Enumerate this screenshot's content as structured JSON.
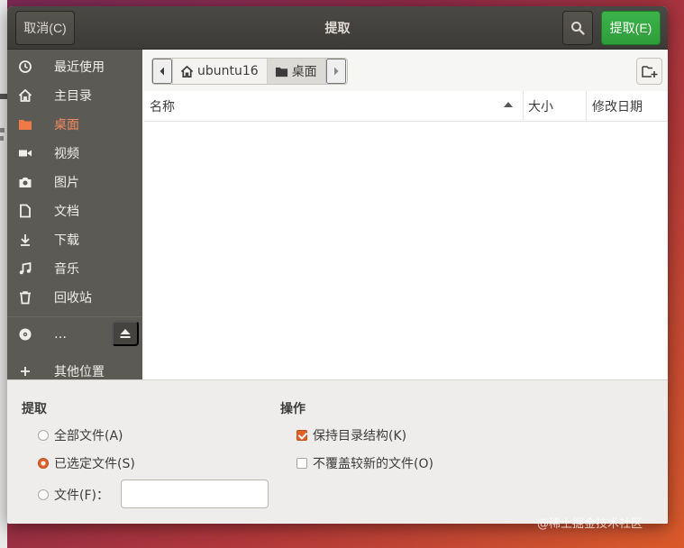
{
  "header": {
    "cancel_label": "取消(C)",
    "title": "提取",
    "extract_label": "提取(E)"
  },
  "sidebar": {
    "items": [
      {
        "label": "最近使用",
        "icon": "clock-icon"
      },
      {
        "label": "主目录",
        "icon": "home-icon"
      },
      {
        "label": "桌面",
        "icon": "folder-icon",
        "active": true
      },
      {
        "label": "视频",
        "icon": "video-icon"
      },
      {
        "label": "图片",
        "icon": "camera-icon"
      },
      {
        "label": "文档",
        "icon": "document-icon"
      },
      {
        "label": "下载",
        "icon": "download-icon"
      },
      {
        "label": "音乐",
        "icon": "music-icon"
      },
      {
        "label": "回收站",
        "icon": "trash-icon"
      },
      {
        "label": "…",
        "icon": "disc-icon"
      },
      {
        "label": "其他位置",
        "icon": "plus-icon"
      }
    ]
  },
  "pathbar": {
    "segments": [
      {
        "label": "ubuntu16",
        "icon": "home-icon"
      },
      {
        "label": "桌面",
        "icon": "folder-icon",
        "active": true
      }
    ]
  },
  "filelist": {
    "columns": [
      "名称",
      "大小",
      "修改日期"
    ]
  },
  "options": {
    "extract": {
      "title": "提取",
      "all_files": "全部文件(A)",
      "selected_files": "已选定文件(S)",
      "files": "文件(F)：",
      "selected": "selected_files",
      "files_value": ""
    },
    "actions": {
      "title": "操作",
      "keep_structure": "保持目录结构(K)",
      "keep_structure_checked": true,
      "no_overwrite": "不覆盖较新的文件(O)",
      "no_overwrite_checked": false
    }
  },
  "watermark": "@稀土掘金技术社区",
  "colors": {
    "accent": "#e0602a",
    "extract_button": "#38a845",
    "sidebar_bg": "#5b5a55",
    "header_bg": "#3c3b37"
  }
}
